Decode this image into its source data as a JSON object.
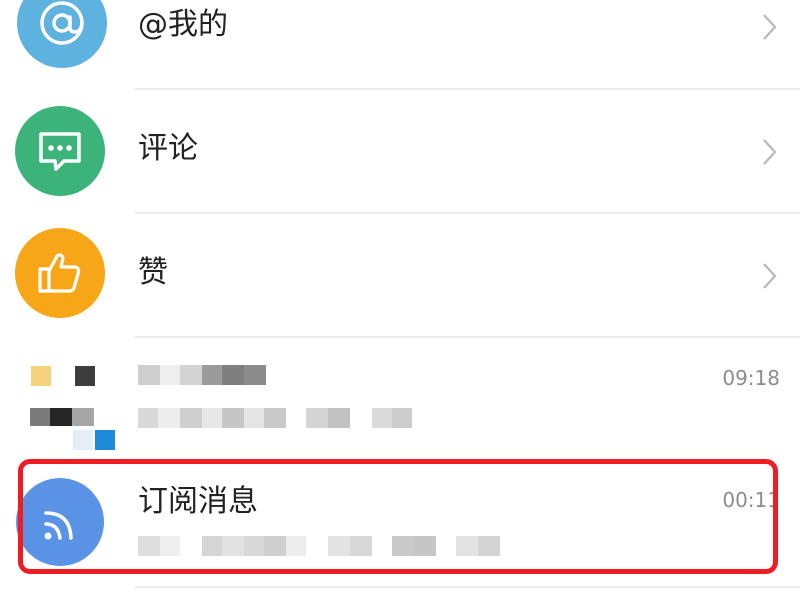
{
  "colors": {
    "mention": "#5eb2df",
    "comment": "#3bb37a",
    "like": "#f6a616",
    "subscription": "#5a92e6",
    "highlight": "#ee1d23"
  },
  "list": {
    "items": [
      {
        "id": "mention",
        "label": "@我的",
        "icon": "at-icon",
        "has_chevron": true
      },
      {
        "id": "comment",
        "label": "评论",
        "icon": "chat-bubble-icon",
        "has_chevron": true
      },
      {
        "id": "like",
        "label": "赞",
        "icon": "thumbs-up-icon",
        "has_chevron": true
      },
      {
        "id": "blurred-chat",
        "label": "",
        "time": "09:18",
        "icon": "pixelated-avatar"
      },
      {
        "id": "subscription",
        "label": "订阅消息",
        "time": "00:11",
        "icon": "rss-icon"
      }
    ]
  }
}
